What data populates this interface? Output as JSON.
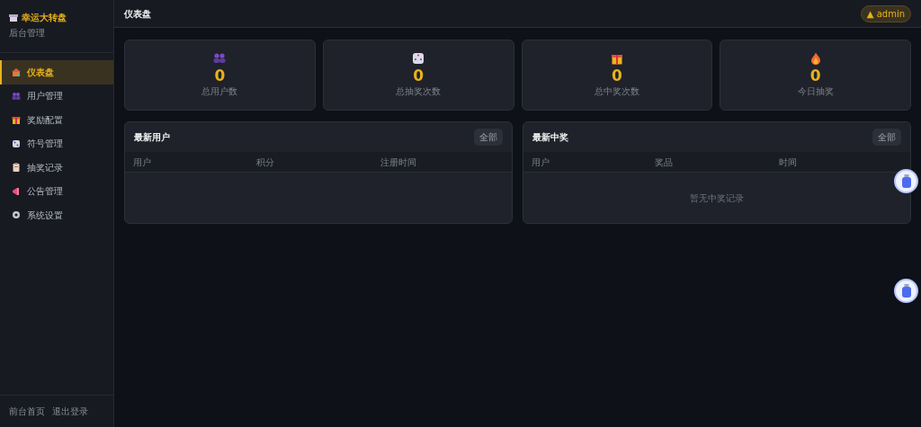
{
  "brand": {
    "title": "幸运大转盘",
    "subtitle": "后台管理"
  },
  "sidebar": {
    "items": [
      {
        "label": "仪表盘",
        "selected": true
      },
      {
        "label": "用户管理",
        "selected": false
      },
      {
        "label": "奖励配置",
        "selected": false
      },
      {
        "label": "符号管理",
        "selected": false
      },
      {
        "label": "抽奖记录",
        "selected": false
      },
      {
        "label": "公告管理",
        "selected": false
      },
      {
        "label": "系统设置",
        "selected": false
      }
    ],
    "footer_links": [
      "前台首页",
      "退出登录"
    ]
  },
  "header": {
    "title": "仪表盘",
    "user_badge": "▲ admin"
  },
  "stats": [
    {
      "value": "0",
      "label": "总用户数"
    },
    {
      "value": "0",
      "label": "总抽奖次数"
    },
    {
      "value": "0",
      "label": "总中奖次数"
    },
    {
      "value": "0",
      "label": "今日抽奖"
    }
  ],
  "panels": [
    {
      "title": "最新用户",
      "button": "全部",
      "columns": [
        "用户",
        "积分",
        "注册时间"
      ]
    },
    {
      "title": "最新中奖",
      "button": "全部",
      "columns": [
        "用户",
        "奖品",
        "时间"
      ],
      "empty_text": "暂无中奖记录"
    }
  ]
}
